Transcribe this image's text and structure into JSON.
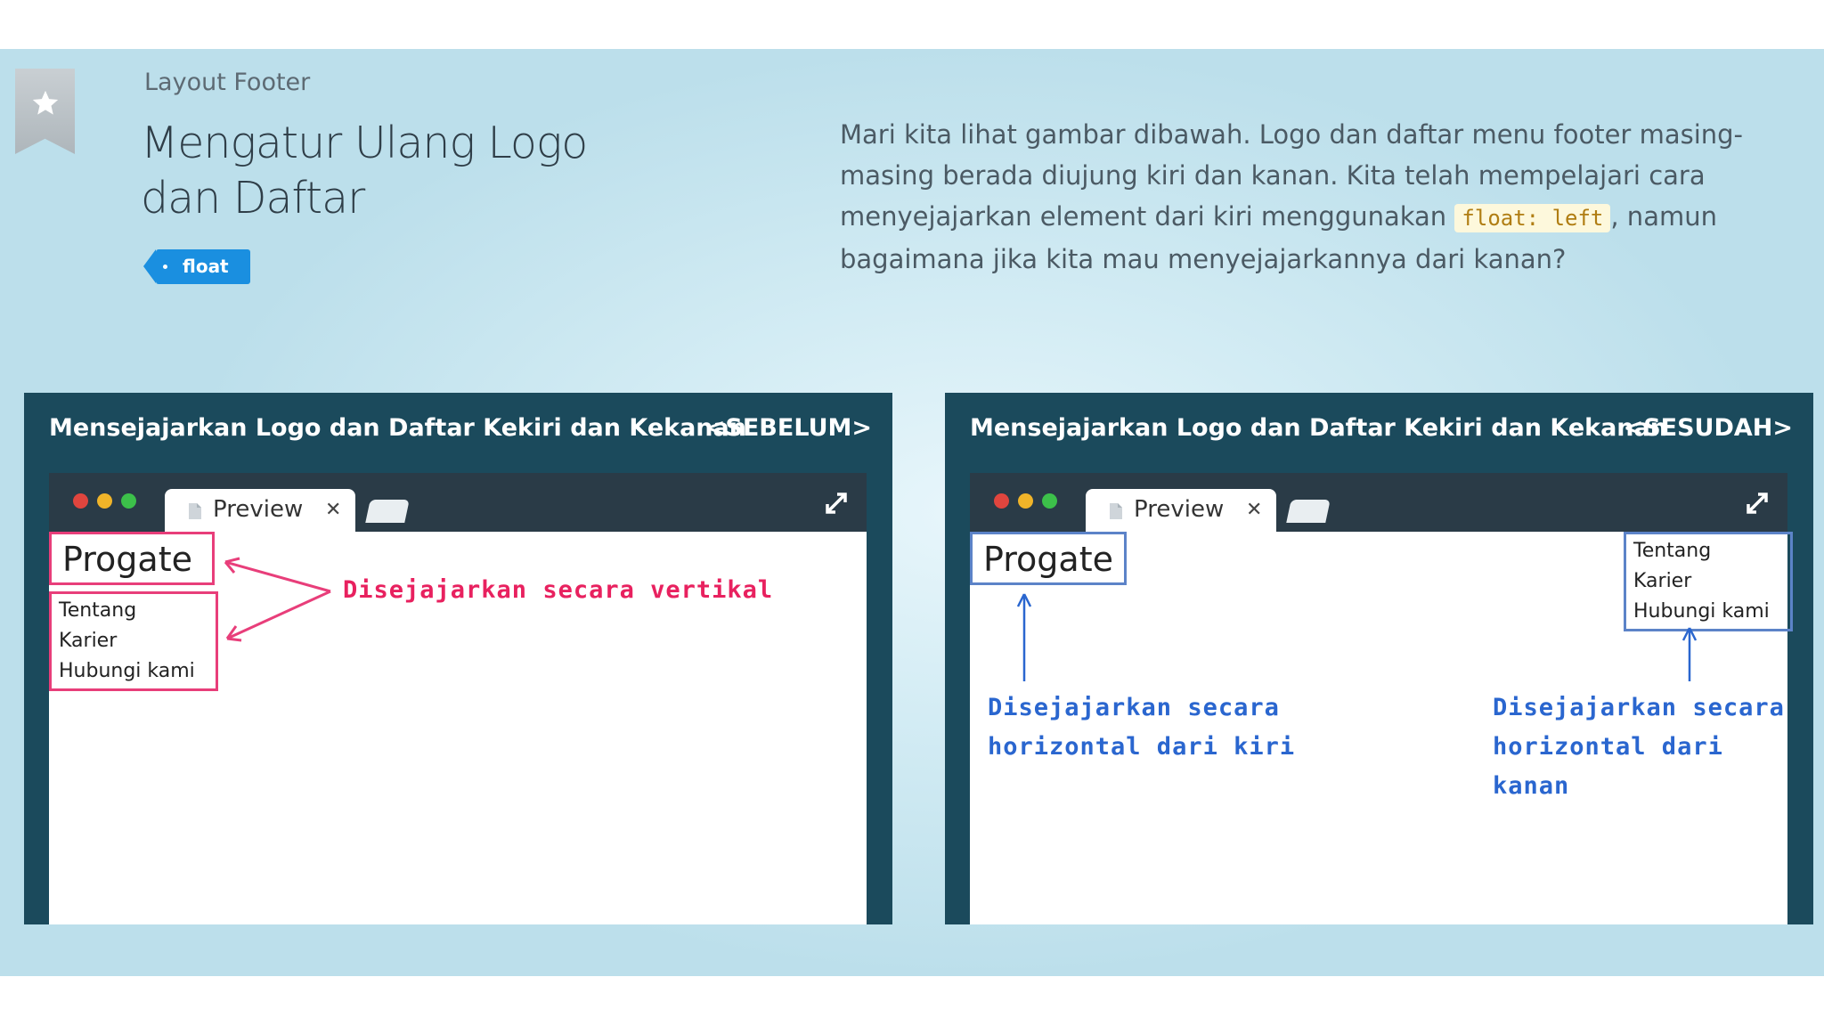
{
  "header": {
    "category": "Layout Footer",
    "title": "Mengatur Ulang Logo dan Daftar",
    "tag": "float"
  },
  "description": {
    "part1": "Mari kita lihat gambar dibawah. Logo dan daftar menu footer masing-masing berada diujung kiri dan kanan. Kita telah mempelajari cara menyejajarkan element dari kiri menggunakan ",
    "code": "float: left",
    "part2": ", namun bagaimana jika kita mau menyejajarkannya dari kanan?"
  },
  "panels": [
    {
      "heading": "Mensejajarkan Logo dan Daftar Kekiri dan Kekanan",
      "state": "<SEBELUM>",
      "tab_label": "Preview",
      "logo": "Progate",
      "menu": [
        "Tentang",
        "Karier",
        "Hubungi kami"
      ],
      "annotation": "Disejajarkan secara vertikal",
      "accent": "#e83e7a"
    },
    {
      "heading": "Mensejajarkan Logo dan Daftar Kekiri dan Kekanan",
      "state": "<SESUDAH>",
      "tab_label": "Preview",
      "logo": "Progate",
      "menu": [
        "Tentang",
        "Karier",
        "Hubungi kami"
      ],
      "annotation_left": [
        "Disejajarkan secara",
        "horizontal dari kiri"
      ],
      "annotation_right": [
        "Disejajarkan secara",
        "horizontal dari kanan"
      ],
      "accent": "#5c83c8"
    }
  ]
}
